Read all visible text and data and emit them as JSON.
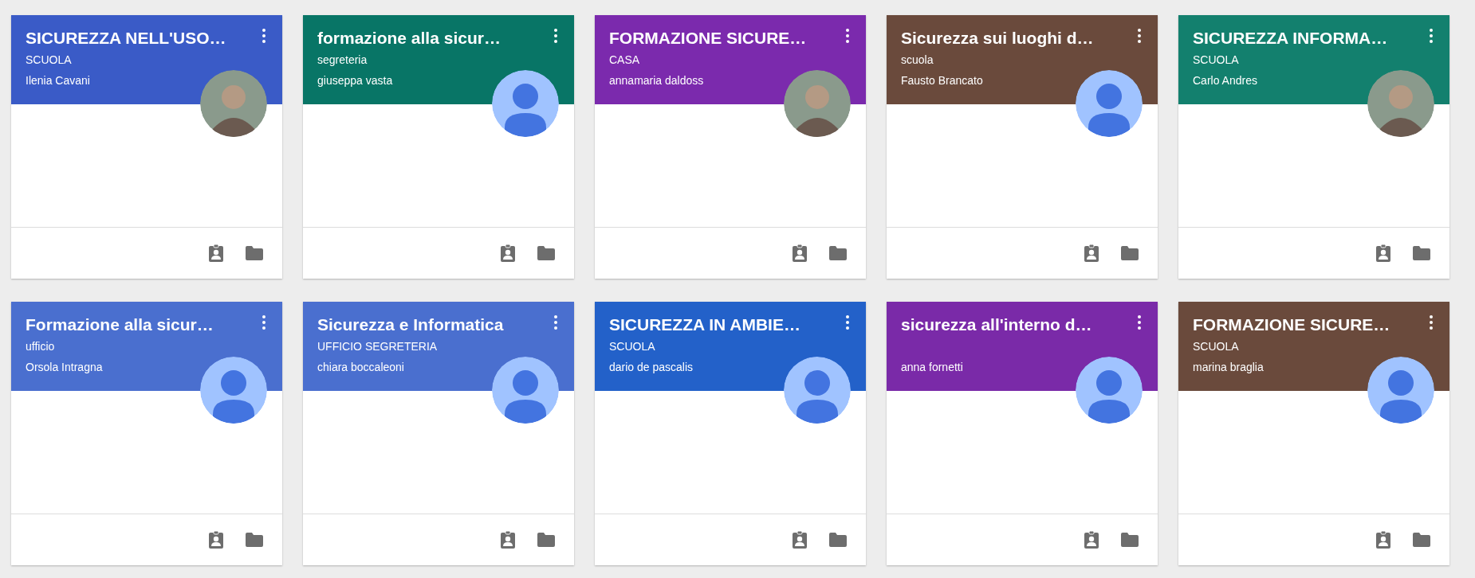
{
  "classes": [
    {
      "title": "SICUREZZA NELL'USO…",
      "section": "SCUOLA",
      "teacher": "Ilenia Cavani",
      "color": "#3a5bc7",
      "avatar": {
        "kind": "photo"
      }
    },
    {
      "title": "formazione alla sicur…",
      "section": "segreteria",
      "teacher": "giuseppa vasta",
      "color": "#087566",
      "avatar": {
        "kind": "default"
      }
    },
    {
      "title": "FORMAZIONE SICURE…",
      "section": "CASA",
      "teacher": "annamaria daldoss",
      "color": "#7b2aad",
      "avatar": {
        "kind": "photo"
      }
    },
    {
      "title": "Sicurezza sui luoghi d…",
      "section": "scuola",
      "teacher": "Fausto Brancato",
      "color": "#6a4a3c",
      "avatar": {
        "kind": "default"
      }
    },
    {
      "title": "SICUREZZA INFORMA…",
      "section": "SCUOLA",
      "teacher": "Carlo Andres",
      "color": "#13806e",
      "avatar": {
        "kind": "photo"
      }
    },
    {
      "title": "Formazione alla sicur…",
      "section": "ufficio",
      "teacher": "Orsola Intragna",
      "color": "#4a6fcf",
      "avatar": {
        "kind": "default"
      }
    },
    {
      "title": "Sicurezza e Informatica",
      "section": "UFFICIO SEGRETERIA",
      "teacher": "chiara boccaleoni",
      "color": "#4a6fcf",
      "avatar": {
        "kind": "default"
      }
    },
    {
      "title": "SICUREZZA IN AMBIE…",
      "section": "SCUOLA",
      "teacher": "dario de pascalis",
      "color": "#2361c9",
      "avatar": {
        "kind": "default"
      }
    },
    {
      "title": "sicurezza all'interno d…",
      "teacher": "anna fornetti",
      "color": "#7a2aa8",
      "avatar": {
        "kind": "default"
      }
    },
    {
      "title": "FORMAZIONE SICURE…",
      "section": "SCUOLA",
      "teacher": "marina braglia",
      "color": "#6a4a3c",
      "avatar": {
        "kind": "default"
      }
    }
  ]
}
